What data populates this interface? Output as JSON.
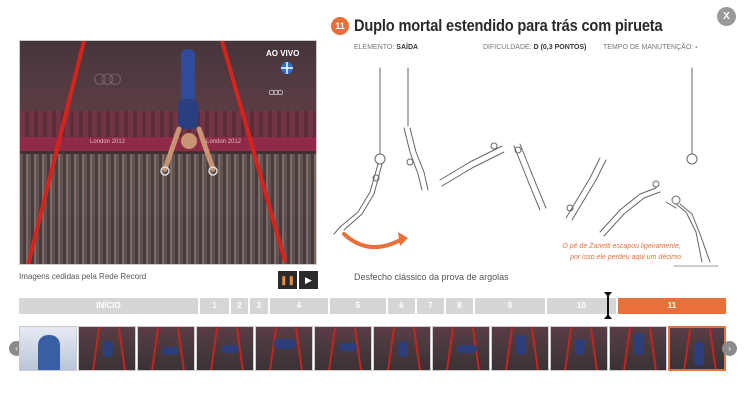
{
  "close_label": "X",
  "move": {
    "number": "11",
    "title": "Duplo mortal estendido para trás com pirueta",
    "element_label": "ELEMENTO:",
    "element_value": "SAÍDA",
    "difficulty_label": "DIFICULDADE:",
    "difficulty_value": "D (0,3 PONTOS)",
    "hold_label": "TEMPO DE MANUTENÇÃO:",
    "hold_value": "-",
    "subtitle": "Desfecho clássico da prova de argolas",
    "note_line1": "O pé de Zanetti escapou ligeiramente,",
    "note_line2": "por isso ele perdeu aqui um décimo"
  },
  "video": {
    "live_label": "AO VIVO",
    "caption": "Imagens cedidas pela Rede Record",
    "banner_text": "London 2012"
  },
  "controls": {
    "pause_icon": "❚❚",
    "play_icon": "▶"
  },
  "timeline": {
    "segments": [
      "INÍCIO",
      "1",
      "2",
      "3",
      "4",
      "5",
      "6",
      "7",
      "8",
      "9",
      "10",
      "11"
    ],
    "active_index": 11
  },
  "nav": {
    "prev_icon": "‹",
    "next_icon": "›"
  },
  "colors": {
    "accent": "#e8703b",
    "segment": "#d6d6d6",
    "rope": "#d8231d"
  }
}
